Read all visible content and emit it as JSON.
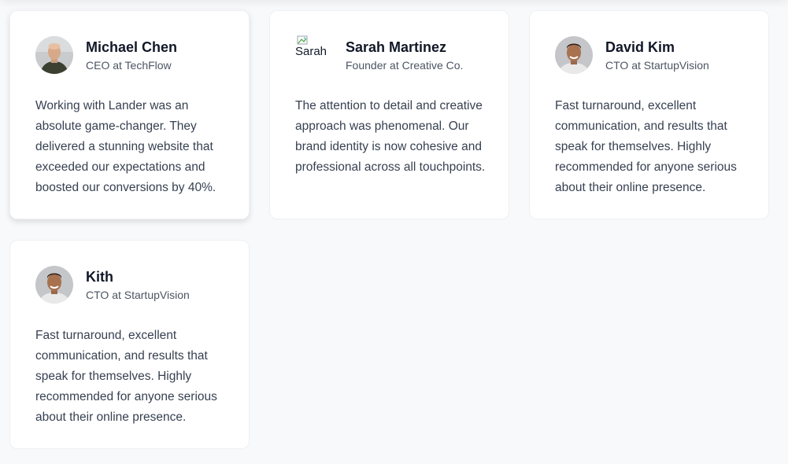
{
  "testimonials": [
    {
      "name": "Michael Chen",
      "role": "CEO at TechFlow",
      "quote": "Working with Lander was an absolute game-changer. They delivered a stunning website that exceeded our expectations and boosted our conversions by 40%.",
      "avatar": "person-photo-bald"
    },
    {
      "name": "Sarah Martinez",
      "role": "Founder at Creative Co.",
      "quote": "The attention to detail and creative approach was phenomenal. Our brand identity is now cohesive and professional across all touchpoints.",
      "avatar_alt": "Sarah"
    },
    {
      "name": "David Kim",
      "role": "CTO at StartupVision",
      "quote": "Fast turnaround, excellent communication, and results that speak for themselves. Highly recommended for anyone serious about their online presence.",
      "avatar": "person-photo-smiling"
    },
    {
      "name": "Kith",
      "role": "CTO at StartupVision",
      "quote": "Fast turnaround, excellent communication, and results that speak for themselves. Highly recommended for anyone serious about their online presence.",
      "avatar": "person-photo-smiling"
    }
  ]
}
